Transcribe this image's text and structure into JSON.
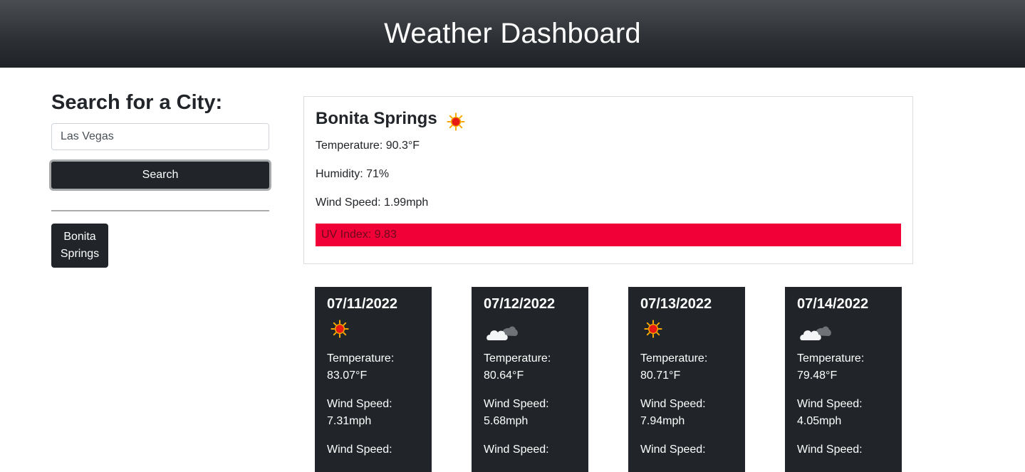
{
  "header": {
    "title": "Weather Dashboard"
  },
  "search": {
    "heading": "Search for a City:",
    "input_value": "Las Vegas",
    "button_label": "Search"
  },
  "history": [
    {
      "label_line1": "Bonita",
      "label_line2": "Springs"
    }
  ],
  "current": {
    "city": "Bonita Springs",
    "icon": "sun-icon",
    "temperature": "Temperature: 90.3°F",
    "humidity": "Humidity: 71%",
    "wind": "Wind Speed: 1.99mph",
    "uv": "UV Index: 9.83",
    "uv_color": "#f00036"
  },
  "forecast": [
    {
      "date": "07/11/2022",
      "icon": "sun-icon",
      "temp_label": "Temperature:",
      "temp_value": "83.07°F",
      "wind_label": "Wind Speed:",
      "wind_value": "7.31mph",
      "wind2_label": "Wind Speed:"
    },
    {
      "date": "07/12/2022",
      "icon": "cloud-icon",
      "temp_label": "Temperature:",
      "temp_value": "80.64°F",
      "wind_label": "Wind Speed:",
      "wind_value": "5.68mph",
      "wind2_label": "Wind Speed:"
    },
    {
      "date": "07/13/2022",
      "icon": "sun-icon",
      "temp_label": "Temperature:",
      "temp_value": "80.71°F",
      "wind_label": "Wind Speed:",
      "wind_value": "7.94mph",
      "wind2_label": "Wind Speed:"
    },
    {
      "date": "07/14/2022",
      "icon": "cloud-icon",
      "temp_label": "Temperature:",
      "temp_value": "79.48°F",
      "wind_label": "Wind Speed:",
      "wind_value": "4.05mph",
      "wind2_label": "Wind Speed:"
    }
  ],
  "colors": {
    "header": "#2e3236",
    "card": "#212529",
    "uv_high": "#f00036"
  }
}
